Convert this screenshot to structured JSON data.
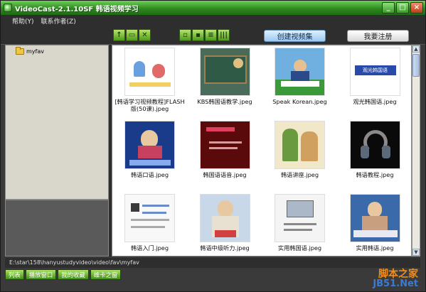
{
  "window": {
    "title": "VideoCast-2.1.10SF 韩语视频学习"
  },
  "menu": [
    {
      "label": "帮助(Y)"
    },
    {
      "label": "联系作者(Z)"
    }
  ],
  "toolbar": {
    "create_label": "创建视频集",
    "register_label": "我要注册"
  },
  "tree": {
    "items": [
      {
        "label": "myfav"
      }
    ]
  },
  "thumbnails": [
    {
      "caption": "[韩语学习视频教程]FLASH版(50课).jpeg",
      "art": "cartoon-white"
    },
    {
      "caption": "KBS韩国语教学.jpeg",
      "art": "green-board"
    },
    {
      "caption": "Speak Korean.jpeg",
      "art": "teacher-blue"
    },
    {
      "caption": "观光韩国语.jpeg",
      "art": "logo-blue"
    },
    {
      "caption": "韩语口语.jpeg",
      "art": "woman-blue"
    },
    {
      "caption": "韩国语语音.jpeg",
      "art": "red-dark"
    },
    {
      "caption": "韩语讲座.jpeg",
      "art": "cartoon-beige"
    },
    {
      "caption": "韩语教程.jpeg",
      "art": "headphones"
    },
    {
      "caption": "韩语入门.jpeg",
      "art": "table-white"
    },
    {
      "caption": "韩语中级听力.jpeg",
      "art": "woman-studio"
    },
    {
      "caption": "实用韩国语.jpeg",
      "art": "slide-white"
    },
    {
      "caption": "实用韩语.jpeg",
      "art": "woman-desk"
    }
  ],
  "status": {
    "path": "E:\\star\\158\\hanyustudyvideo\\video\\fav\\myfav"
  },
  "bottom_tabs": [
    {
      "label": "列表"
    },
    {
      "label": "播放窗口"
    },
    {
      "label": "我的收藏"
    },
    {
      "label": "维卡之窗"
    }
  ],
  "watermark": {
    "line1": "脚本之家",
    "line2": "JB51.Net"
  },
  "colors": {
    "titlebar": "#2e8a1e",
    "accent_green": "#4e9a1c",
    "dark_bg": "#2e2e2e",
    "content_bg": "#ffffff"
  }
}
